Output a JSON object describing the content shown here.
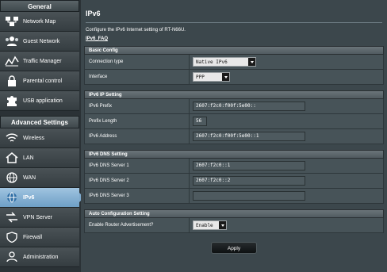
{
  "sidebar": {
    "general_header": "General",
    "general_items": [
      {
        "label": "Network Map",
        "icon": "network-map-icon"
      },
      {
        "label": "Guest Network",
        "icon": "guest-network-icon"
      },
      {
        "label": "Traffic Manager",
        "icon": "traffic-manager-icon"
      },
      {
        "label": "Parental control",
        "icon": "parental-control-icon"
      },
      {
        "label": "USB application",
        "icon": "usb-application-icon"
      }
    ],
    "advanced_header": "Advanced Settings",
    "advanced_items": [
      {
        "label": "Wireless",
        "icon": "wireless-icon"
      },
      {
        "label": "LAN",
        "icon": "lan-icon"
      },
      {
        "label": "WAN",
        "icon": "wan-icon"
      },
      {
        "label": "IPv6",
        "icon": "ipv6-icon",
        "active": true
      },
      {
        "label": "VPN Server",
        "icon": "vpn-server-icon"
      },
      {
        "label": "Firewall",
        "icon": "firewall-icon"
      },
      {
        "label": "Administration",
        "icon": "administration-icon"
      }
    ]
  },
  "main": {
    "title": "IPv6",
    "description": "Configure the IPv6 Internet setting of RT-N66U.",
    "faq_link": "IPv6_FAQ",
    "basic": {
      "header": "Basic Config",
      "connection_type_label": "Connection type",
      "connection_type_value": "Native IPv6",
      "interface_label": "Interface",
      "interface_value": "PPP"
    },
    "ip": {
      "header": "IPv6 IP Setting",
      "prefix_label": "IPv6 Prefix",
      "prefix_value": "2607:f2c0:f00f:5e00::",
      "prefix_length_label": "Prefix Length",
      "prefix_length_value": "56",
      "address_label": "IPv6 Address",
      "address_value": "2607:f2c0:f00f:5e00::1"
    },
    "dns": {
      "header": "IPv6 DNS Setting",
      "dns1_label": "IPv6 DNS Server 1",
      "dns1_value": "2607:f2c0::1",
      "dns2_label": "IPv6 DNS Server 2",
      "dns2_value": "2607:f2c0::2",
      "dns3_label": "IPv6 DNS Server 3",
      "dns3_value": ""
    },
    "auto": {
      "header": "Auto Configuration Setting",
      "ra_label": "Enable Router Advertisement?",
      "ra_value": "Enable"
    },
    "apply_label": "Apply"
  },
  "colors": {
    "sidebar_bg": "#2b3236",
    "active_item": "#7ea9cc",
    "main_bg": "#3c474c",
    "section_header": "#5e686d"
  }
}
